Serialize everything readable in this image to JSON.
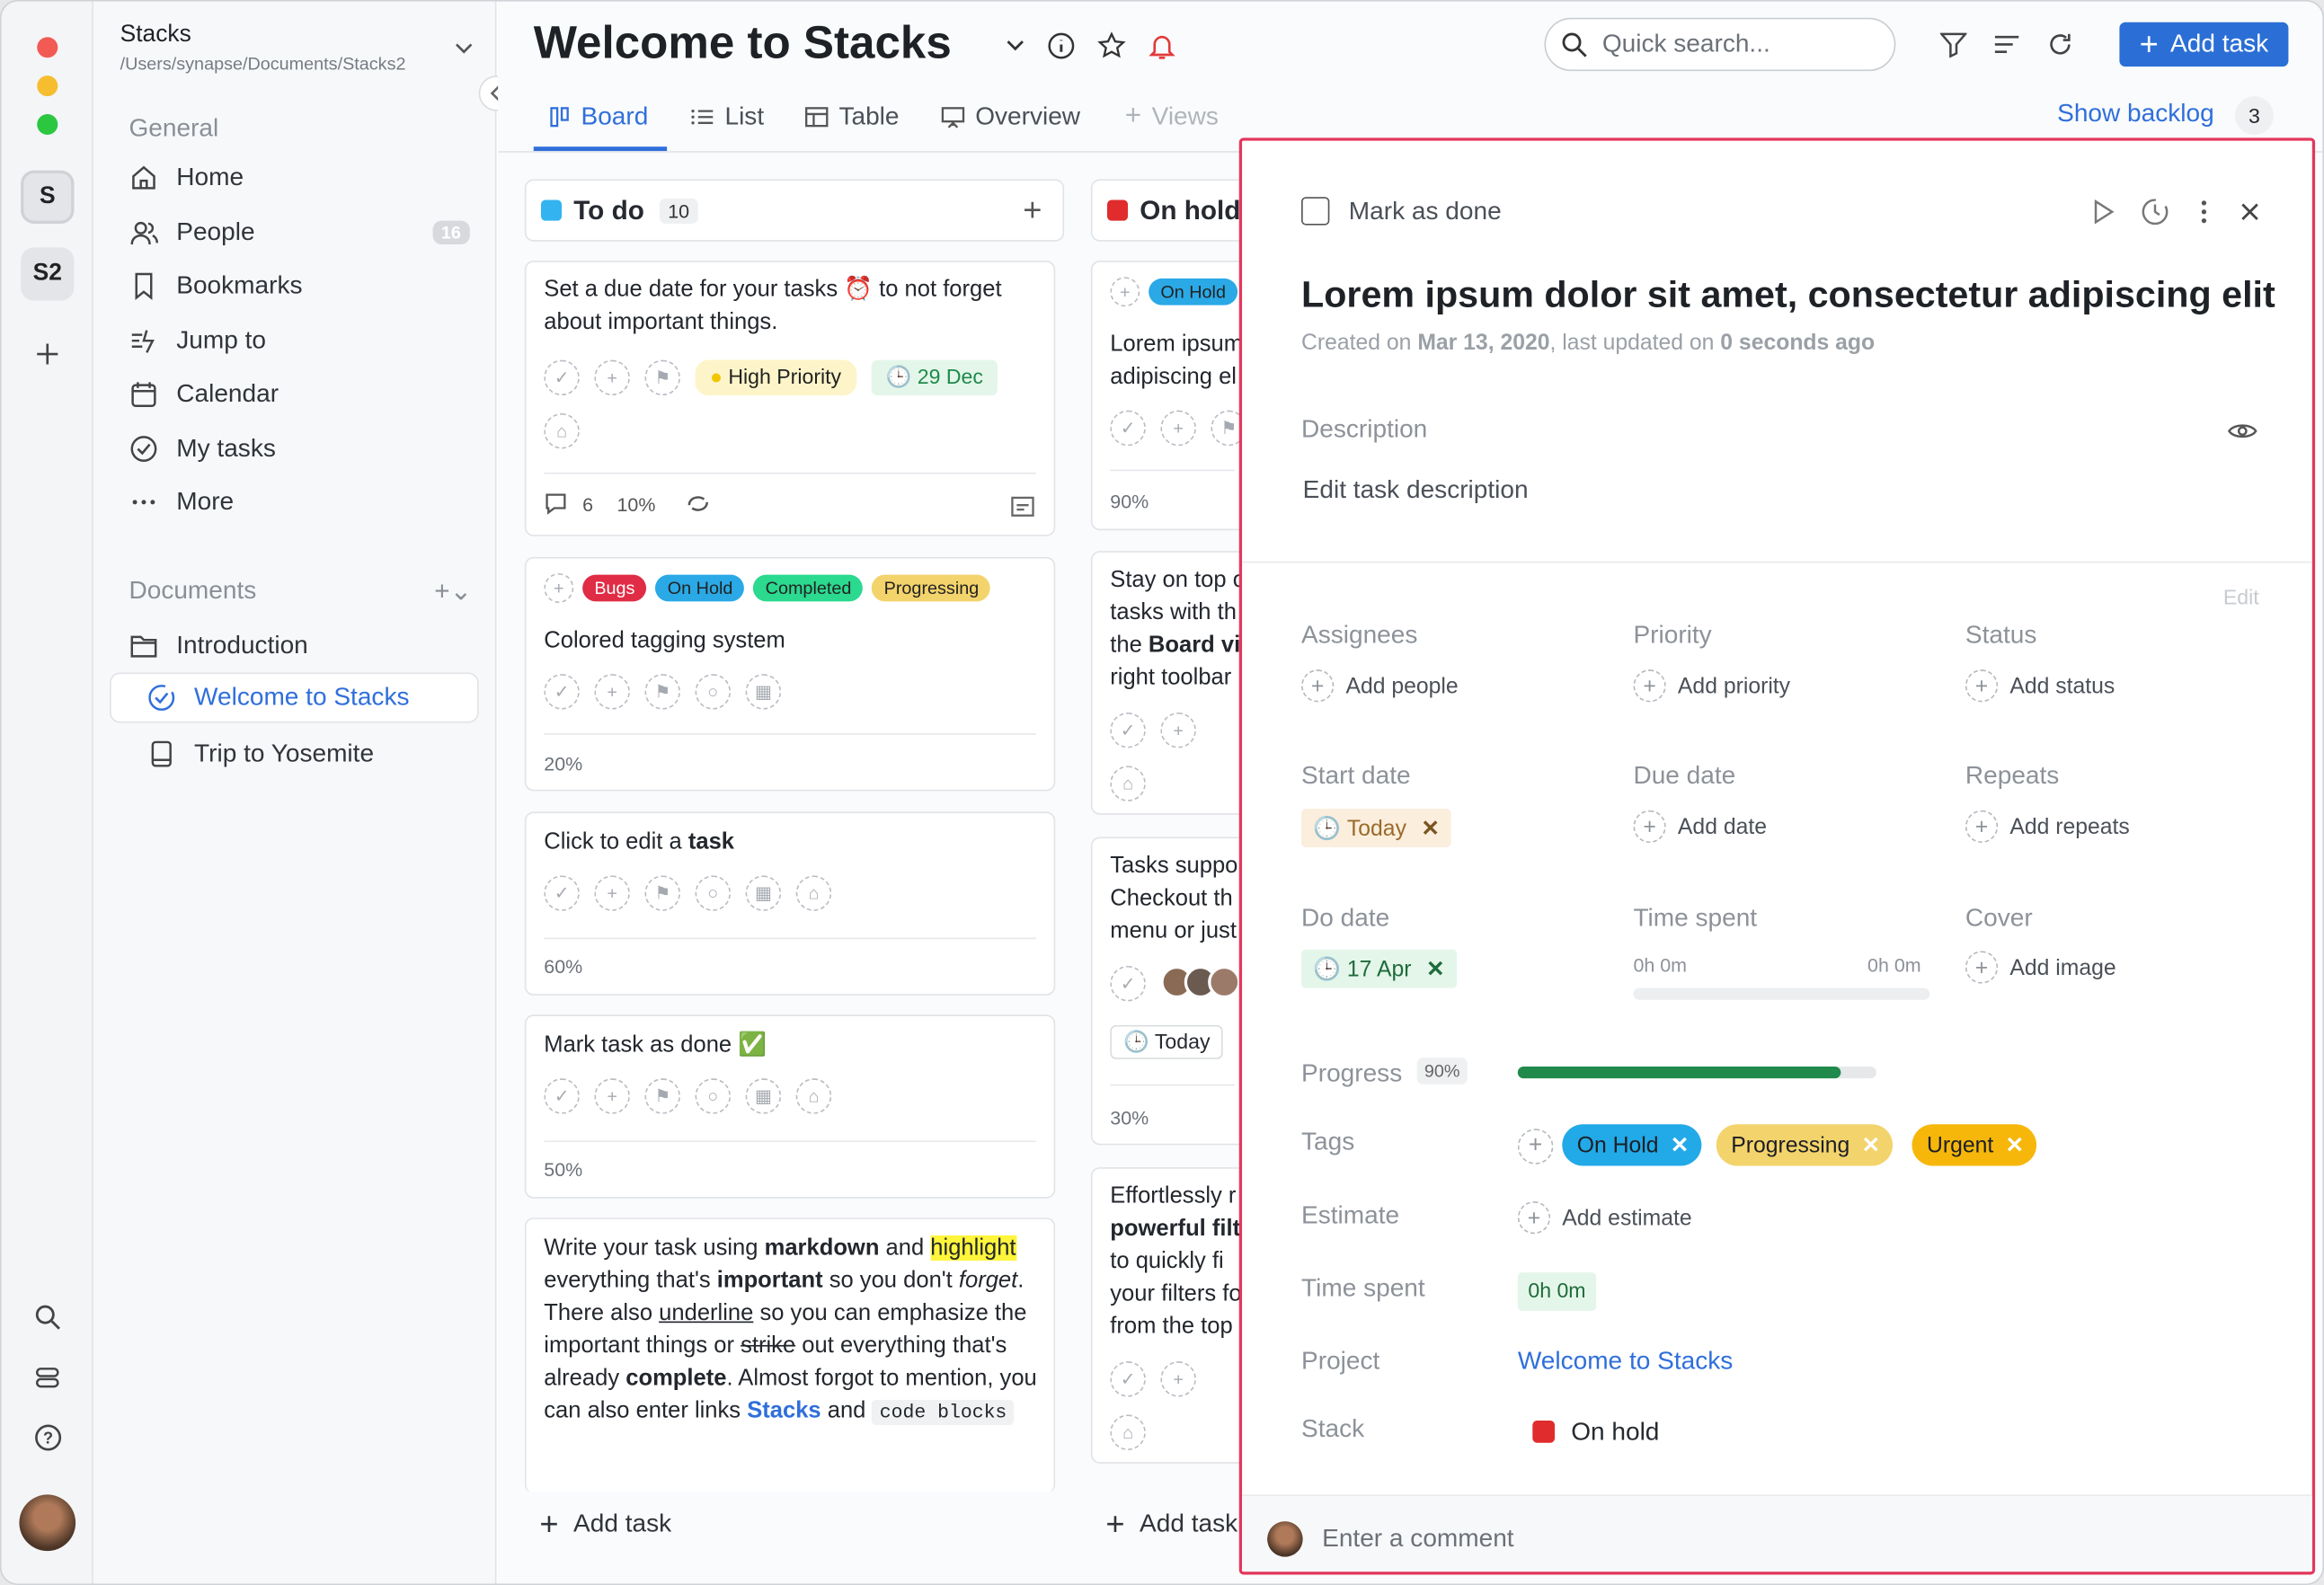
{
  "workspaces": [
    "S",
    "S2"
  ],
  "project": {
    "name": "Stacks",
    "path": "/Users/synapse/Documents/Stacks2"
  },
  "sidebar": {
    "general_title": "General",
    "nav": [
      {
        "label": "Home",
        "icon": "home-icon"
      },
      {
        "label": "People",
        "count": "16",
        "icon": "people-icon"
      },
      {
        "label": "Bookmarks",
        "icon": "bookmark-icon"
      },
      {
        "label": "Jump to",
        "icon": "jump-icon"
      },
      {
        "label": "Calendar",
        "icon": "calendar-icon"
      },
      {
        "label": "My tasks",
        "icon": "check-circle-icon"
      },
      {
        "label": "More",
        "icon": "more-icon"
      }
    ],
    "documents_title": "Documents",
    "docs": [
      {
        "label": "Introduction"
      },
      {
        "label": "Welcome to Stacks"
      },
      {
        "label": "Trip to Yosemite"
      }
    ]
  },
  "header": {
    "title": "Welcome to Stacks",
    "search_placeholder": "Quick search...",
    "add_task": "Add task",
    "tabs": [
      "Board",
      "List",
      "Table",
      "Overview",
      "Views"
    ],
    "show_backlog": "Show backlog",
    "backlog_count": "3"
  },
  "columns": [
    {
      "name": "To do",
      "count": "10",
      "color": "#33b4f0"
    },
    {
      "name": "On hold",
      "color": "#e02c2c"
    }
  ],
  "todo": {
    "c1": {
      "text_a": "Set a due date for your tasks ⏰ to not forget",
      "text_b": "about important things.",
      "priority": "High Priority",
      "due": "29 Dec",
      "comments": "6",
      "pct": "10%"
    },
    "c2": {
      "tags": [
        "Bugs",
        "On Hold",
        "Completed",
        "Progressing"
      ],
      "text": "Colored tagging system",
      "pct": "20%"
    },
    "c3": {
      "text": "Click to edit a",
      "bold": "task",
      "pct": "60%"
    },
    "c4": {
      "text": "Mark task as done ✅",
      "pct": "50%"
    },
    "c5": {
      "w": [
        "Write your task using ",
        "markdown",
        " and ",
        "highlight",
        " everything that's ",
        "important",
        " so you don't ",
        "forget",
        ". There also ",
        "underline",
        " so you can emphasize the important things or ",
        "strike",
        " out everything that's already ",
        "complete",
        ". Almost forgot to mention, you can also enter links ",
        "Stacks",
        " and ",
        "code blocks"
      ]
    },
    "add": "Add task"
  },
  "onhold": {
    "c1": {
      "tag": "On Hold",
      "l1": "Lorem ipsum",
      "l2": "adipiscing el",
      "pct": "90%"
    },
    "c2": {
      "l1": "Stay on top o",
      "l2": "tasks with th",
      "l3a": "the ",
      "l3b": "Board vi",
      "l4": "right toolbar"
    },
    "c3": {
      "l1": "Tasks suppo",
      "l2": "Checkout th",
      "l3": "menu or just",
      "today": "Today",
      "pct": "30%"
    },
    "c4": {
      "l1": "Effortlessly r",
      "l2": "powerful filt",
      "l3": "to quickly fi",
      "l4": "your filters fo",
      "l5": "from the top"
    },
    "add": "Add task"
  },
  "detail": {
    "mark_done": "Mark as done",
    "title": "Lorem ipsum dolor sit amet, consectetur adipiscing elit",
    "meta": {
      "p1": "Created on ",
      "created": "Mar 13, 2020",
      "p2": ", last updated on ",
      "updated": "0 seconds ago"
    },
    "description_label": "Description",
    "description_placeholder": "Edit task description",
    "edit": "Edit",
    "fields": {
      "assignees": "Assignees",
      "add_people": "Add people",
      "priority": "Priority",
      "add_priority": "Add priority",
      "status": "Status",
      "add_status": "Add status",
      "start_date": "Start date",
      "start_val": "Today",
      "due_date": "Due date",
      "add_date": "Add date",
      "repeats": "Repeats",
      "add_repeats": "Add repeats",
      "do_date": "Do date",
      "do_val": "17 Apr",
      "time_spent": "Time spent",
      "ts_a": "0h 0m",
      "ts_b": "0h 0m",
      "cover": "Cover",
      "add_image": "Add image"
    },
    "progress_label": "Progress",
    "progress_pct": "90%",
    "progress_value": 0.9,
    "tags_label": "Tags",
    "tags": [
      {
        "label": "On Hold",
        "color": "#22a9e8"
      },
      {
        "label": "Progressing",
        "color": "#f3d36b"
      },
      {
        "label": "Urgent",
        "color": "#f6b70a"
      }
    ],
    "estimate_label": "Estimate",
    "add_estimate": "Add estimate",
    "time_spent_label": "Time spent",
    "time_spent_val": "0h 0m",
    "project_label": "Project",
    "project_val": "Welcome to Stacks",
    "stack_label": "Stack",
    "stack_val": "On hold",
    "comment_placeholder": "Enter a comment"
  },
  "colors": {
    "accent": "#2f6fdb",
    "add_btn": "#2b6fd6",
    "highlight": "#e3375b",
    "progress": "#1f8a4c"
  }
}
